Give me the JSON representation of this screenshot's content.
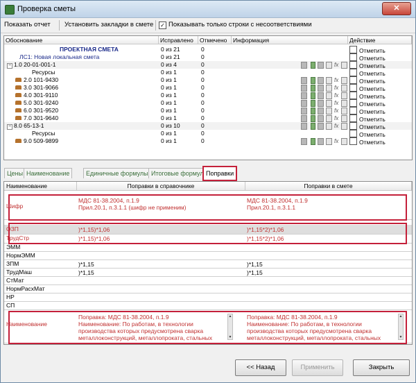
{
  "window": {
    "title": "Проверка сметы",
    "close_symbol": "✕"
  },
  "toolbar": {
    "show_report": "Показать отчет",
    "set_bookmarks": "Установить закладки в смете",
    "only_mismatch_label": "Показывать только строки с несоответствиями",
    "only_mismatch_checked": true
  },
  "tree": {
    "columns": [
      "Обоснование",
      "Исправлено",
      "Отмечено",
      "Информация",
      "Действие"
    ],
    "action_label": "Отметить",
    "rows": [
      {
        "name": "ПРОЕКТНАЯ СМЕТА",
        "fixed": "0 из 21",
        "marked": "0",
        "kind": "root",
        "icons": false
      },
      {
        "name": "ЛС1: Новая локальная смета",
        "fixed": "0 из 21",
        "marked": "0",
        "kind": "ls",
        "icons": false
      },
      {
        "name": "1.0   20-01-001-1",
        "fixed": "0 из 4",
        "marked": "0",
        "kind": "exp",
        "icons": true
      },
      {
        "name": "Ресурсы",
        "fixed": "0 из 1",
        "marked": "0",
        "kind": "res",
        "icons": false
      },
      {
        "name": "2.0   101-9430",
        "fixed": "0 из 1",
        "marked": "0",
        "kind": "item",
        "icons": true
      },
      {
        "name": "3.0   301-9066",
        "fixed": "0 из 1",
        "marked": "0",
        "kind": "item",
        "icons": true
      },
      {
        "name": "4.0   301-9110",
        "fixed": "0 из 1",
        "marked": "0",
        "kind": "item",
        "icons": true
      },
      {
        "name": "5.0   301-9240",
        "fixed": "0 из 1",
        "marked": "0",
        "kind": "item",
        "icons": true
      },
      {
        "name": "6.0   301-9520",
        "fixed": "0 из 1",
        "marked": "0",
        "kind": "item",
        "icons": true
      },
      {
        "name": "7.0   301-9640",
        "fixed": "0 из 1",
        "marked": "0",
        "kind": "item",
        "icons": true
      },
      {
        "name": "8.0   65-13-1",
        "fixed": "0 из 10",
        "marked": "0",
        "kind": "exp",
        "icons": true
      },
      {
        "name": "Ресурсы",
        "fixed": "0 из 1",
        "marked": "0",
        "kind": "res",
        "icons": false
      },
      {
        "name": "9.0   509-9899",
        "fixed": "0 из 1",
        "marked": "0",
        "kind": "item",
        "icons": true
      }
    ]
  },
  "tabs": [
    "Цены",
    "Наименование",
    "Единичные формулы",
    "Итоговые формулы",
    "Поправки"
  ],
  "active_tab": 4,
  "grid": {
    "columns": [
      "Наименование",
      "Поправки в справочнике",
      "Поправки в смете"
    ],
    "rows": [
      {
        "name": "Шифр",
        "ref": "МДС 81-38.2004, п.1.9\nПрил.20.1, п.3.1.1 (шифр не применим)",
        "est": "МДС 81-38.2004, п.1.9\nПрил.20.1, п.3.1.1",
        "red": true
      },
      {
        "name": "ОЗП",
        "ref": ")*1,15)*1,06",
        "est": ")*1,15*2)*1,06",
        "red": true
      },
      {
        "name": "ТрудСтр",
        "ref": ")*1,15)*1,06",
        "est": ")*1,15*2)*1,06",
        "red": true
      },
      {
        "name": "ЭММ",
        "ref": "",
        "est": "",
        "red": false
      },
      {
        "name": "НормЭММ",
        "ref": "",
        "est": "",
        "red": false
      },
      {
        "name": "ЗПМ",
        "ref": ")*1,15",
        "est": ")*1,15",
        "red": false
      },
      {
        "name": "ТрудМаш",
        "ref": ")*1,15",
        "est": ")*1,15",
        "red": false
      },
      {
        "name": "СтМат",
        "ref": "",
        "est": "",
        "red": false
      },
      {
        "name": "НормРасхМат",
        "ref": "",
        "est": "",
        "red": false
      },
      {
        "name": "НР",
        "ref": "",
        "est": "",
        "red": false
      },
      {
        "name": "СП",
        "ref": "",
        "est": "",
        "red": false
      },
      {
        "name": "Наименование",
        "ref": "Поправка: МДС 81-38.2004, п.1.9\nНаименование: По работам, в технологии\nпроизводства которых предусмотрена сварка\nметаллоконструкций, металлопроката, стальных",
        "est": "Поправка: МДС 81-38.2004, п.1.9\nНаименование: По работам, в технологии\nпроизводства которых предусмотрена сварка\nметаллоконструкций, металлопроката, стальных",
        "red": true
      }
    ]
  },
  "buttons": {
    "back": "<< Назад",
    "apply": "Применить",
    "close": "Закрыть"
  }
}
